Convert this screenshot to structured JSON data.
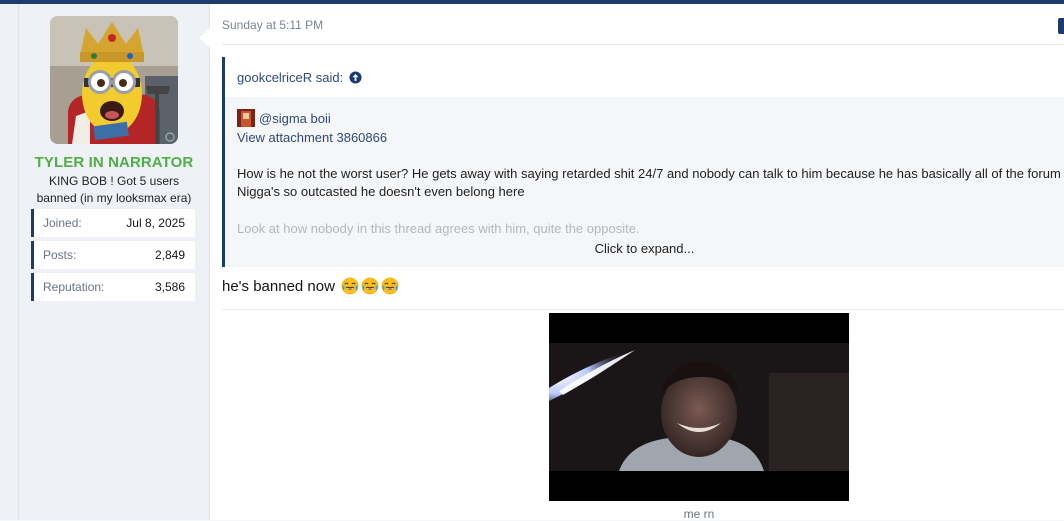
{
  "user": {
    "name": "TYLER IN NARRATOR",
    "title": "KING BOB ! Got 5 users banned (in my looksmax era)",
    "stats": [
      {
        "label": "Joined:",
        "value": "Jul 8, 2025"
      },
      {
        "label": "Posts:",
        "value": "2,849"
      },
      {
        "label": "Reputation:",
        "value": "3,586"
      }
    ],
    "colors": {
      "username": "#4fae46",
      "accent": "#1e3b6e"
    }
  },
  "post": {
    "date": "Sunday at 5:11 PM",
    "quote": {
      "author_label": "gookcelriceR said:",
      "mention": "@sigma boii",
      "attachment_link": "View attachment 3860866",
      "line1": "How is he not the worst user? He gets away with saying retarded shit 24/7 and nobody can talk to him because he has basically all of the forum",
      "line2": "Nigga's so outcasted he doesn't even belong here",
      "faded_line": "Look at how nobody in this thread agrees with him, quite the opposite.",
      "expand_label": "Click to expand..."
    },
    "reply_text": "he's banned now",
    "emoji_icons": [
      "joy-emoji-icon",
      "joy-emoji-icon",
      "joy-emoji-icon"
    ],
    "media_caption": "me rn"
  }
}
